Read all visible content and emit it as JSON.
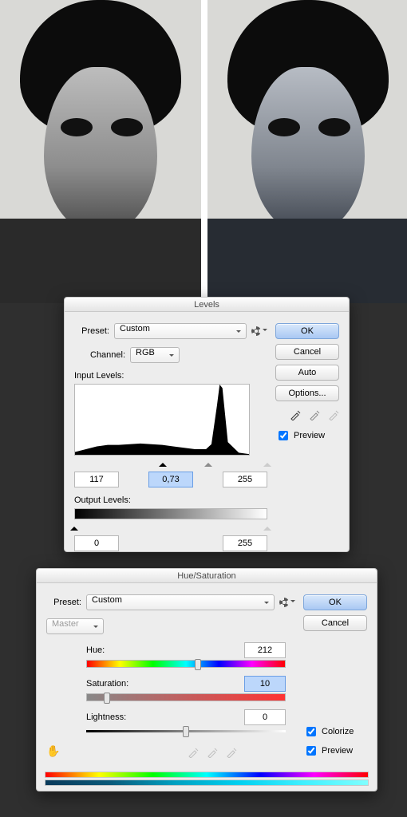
{
  "levels": {
    "title": "Levels",
    "preset_label": "Preset:",
    "preset_value": "Custom",
    "channel_label": "Channel:",
    "channel_value": "RGB",
    "input_levels_label": "Input Levels:",
    "shadows": "117",
    "midtones": "0,73",
    "highlights": "255",
    "output_levels_label": "Output Levels:",
    "out_low": "0",
    "out_high": "255",
    "ok": "OK",
    "cancel": "Cancel",
    "auto": "Auto",
    "options": "Options...",
    "preview": "Preview"
  },
  "huesat": {
    "title": "Hue/Saturation",
    "preset_label": "Preset:",
    "preset_value": "Custom",
    "scope": "Master",
    "hue_label": "Hue:",
    "hue_value": "212",
    "sat_label": "Saturation:",
    "sat_value": "10",
    "light_label": "Lightness:",
    "light_value": "0",
    "colorize": "Colorize",
    "preview": "Preview",
    "ok": "OK",
    "cancel": "Cancel"
  },
  "chart_data": {
    "type": "bar",
    "title": "Input Levels histogram",
    "xlabel": "",
    "ylabel": "",
    "x": [
      0,
      16,
      32,
      48,
      64,
      80,
      96,
      112,
      128,
      144,
      160,
      176,
      192,
      200,
      208,
      212,
      216,
      224,
      240,
      255
    ],
    "values": [
      4,
      8,
      12,
      14,
      14,
      15,
      16,
      15,
      14,
      12,
      10,
      8,
      8,
      15,
      70,
      100,
      95,
      18,
      3,
      1
    ],
    "ylim": [
      0,
      100
    ],
    "input_black": 117,
    "input_gamma": 0.73,
    "input_white": 255,
    "output_black": 0,
    "output_white": 255
  }
}
